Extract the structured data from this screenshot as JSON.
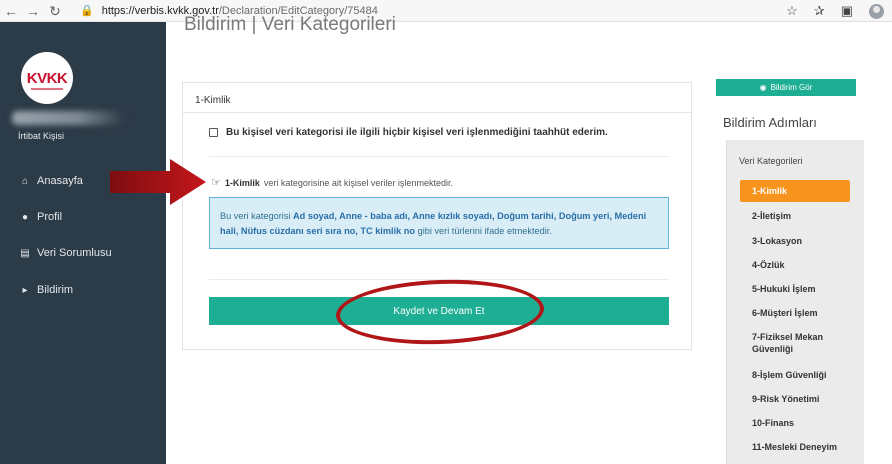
{
  "browser": {
    "url_host": "https://verbis.kvkk.gov.tr",
    "url_path": "/Declaration/EditCategory/75484"
  },
  "sidebar": {
    "logo_text": "KVKK",
    "contact_label": "İrtibat Kişisi",
    "items": [
      {
        "label": "Anasayfa",
        "icon": "home-icon"
      },
      {
        "label": "Profil",
        "icon": "user-icon"
      },
      {
        "label": "Veri Sorumlusu",
        "icon": "database-icon"
      },
      {
        "label": "Bildirim",
        "icon": "bullhorn-icon"
      }
    ]
  },
  "main": {
    "page_title": "Bildirim | Veri Kategorileri",
    "panel_title": "1-Kimlik",
    "no_process_checkbox_label": "Bu kişisel veri kategorisi ile ilgili hiçbir kişisel veri işlenmediğini taahhüt ederim.",
    "info_category": "1-Kimlik",
    "info_rest": "veri kategorisine ait kişisel veriler işlenmektedir.",
    "alert_prefix": "Bu veri kategorisi",
    "alert_items": "Ad soyad, Anne - baba adı, Anne kızlık soyadı, Doğum tarihi, Doğum yeri, Medeni hali, Nüfus cüzdanı seri sıra no, TC kimlik no",
    "alert_suffix": "gibi veri türlerini ifade etmektedir.",
    "save_button": "Kaydet ve Devam Et"
  },
  "right": {
    "view_button": "Bildirim Gör",
    "steps_title": "Bildirim Adımları",
    "steps_subtitle": "Veri Kategorileri",
    "steps": [
      "1-Kimlik",
      "2-İletişim",
      "3-Lokasyon",
      "4-Özlük",
      "5-Hukuki İşlem",
      "6-Müşteri İşlem",
      "7-Fiziksel Mekan Güvenliği",
      "8-İşlem Güvenliği",
      "9-Risk Yönetimi",
      "10-Finans",
      "11-Mesleki Deneyim"
    ],
    "active_step": "1-Kimlik"
  },
  "colors": {
    "sidebar_bg": "#2c3b48",
    "accent_green": "#1eae93",
    "active_step": "#f7941e",
    "annotation_red": "#b01518",
    "alert_bg": "#d9edf7"
  }
}
